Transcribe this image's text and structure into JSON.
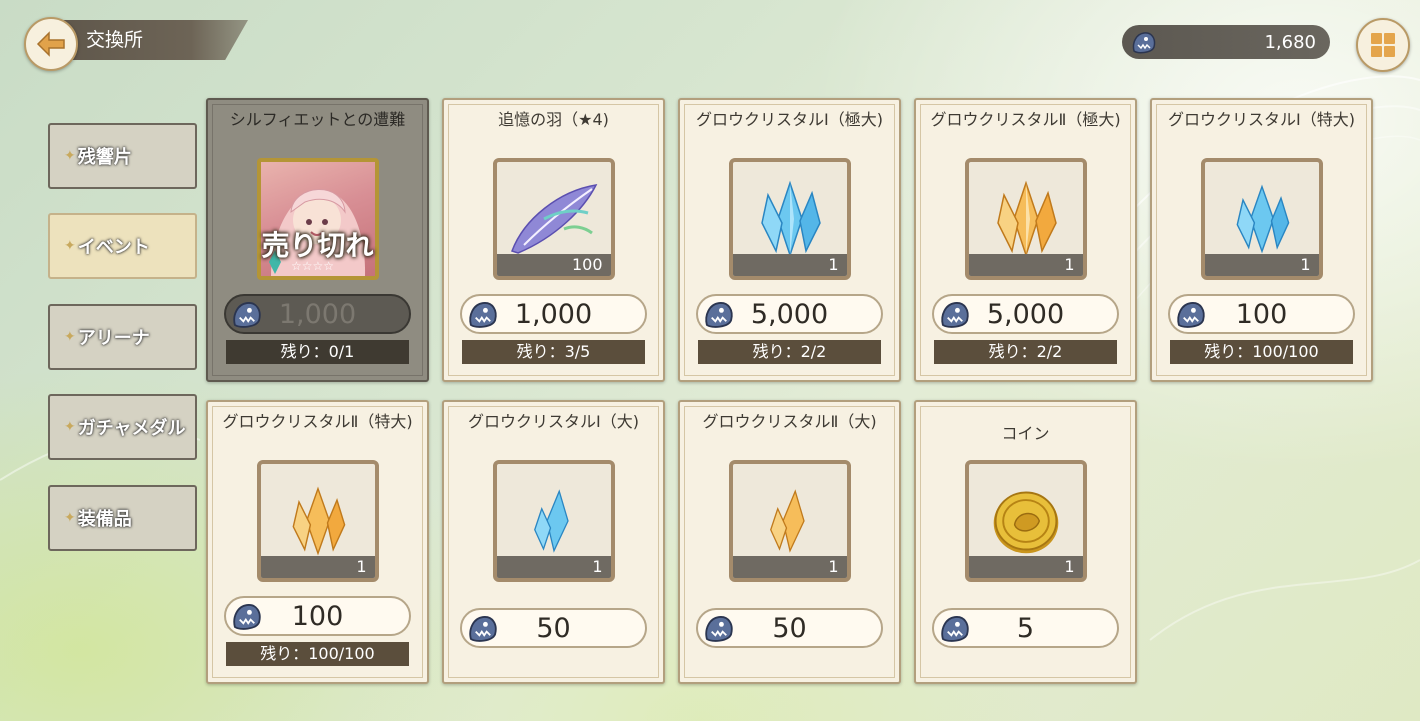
{
  "header": {
    "title": "交換所",
    "currency_amount": "1,680"
  },
  "sidebar": {
    "items": [
      {
        "label": "残響片",
        "active": false
      },
      {
        "label": "イベント",
        "active": true
      },
      {
        "label": "アリーナ",
        "active": false
      },
      {
        "label": "ガチャメダル",
        "active": false
      },
      {
        "label": "装備品",
        "active": false
      }
    ]
  },
  "items": [
    {
      "name": "シルフィエットとの遭難",
      "price": "1,000",
      "remaining": "残り：0/1",
      "sold_out": true,
      "sold_out_label": "売り切れ",
      "icon": "character-portrait"
    },
    {
      "name": "追憶の羽（★4)",
      "price": "1,000",
      "remaining": "残り：3/5",
      "quantity": "100",
      "icon": "feather-icon"
    },
    {
      "name": "グロウクリスタルⅠ（極大)",
      "price": "5,000",
      "remaining": "残り：2/2",
      "quantity": "1",
      "icon": "blue-crystal-icon"
    },
    {
      "name": "グロウクリスタルⅡ（極大)",
      "price": "5,000",
      "remaining": "残り：2/2",
      "quantity": "1",
      "icon": "gold-crystal-icon"
    },
    {
      "name": "グロウクリスタルⅠ（特大)",
      "price": "100",
      "remaining": "残り：100/100",
      "quantity": "1",
      "icon": "blue-crystal-icon"
    },
    {
      "name": "グロウクリスタルⅡ（特大)",
      "price": "100",
      "remaining": "残り：100/100",
      "quantity": "1",
      "icon": "gold-crystal-icon"
    },
    {
      "name": "グロウクリスタルⅠ（大)",
      "price": "50",
      "quantity": "1",
      "icon": "blue-crystal-icon"
    },
    {
      "name": "グロウクリスタルⅡ（大)",
      "price": "50",
      "quantity": "1",
      "icon": "gold-crystal-icon"
    },
    {
      "name": "コイン",
      "price": "5",
      "quantity": "1",
      "icon": "gold-coin-icon"
    }
  ],
  "colors": {
    "accent_gold": "#b99a66",
    "card_bg": "#f7f1e2",
    "remain_bar": "#5b4e3c"
  }
}
